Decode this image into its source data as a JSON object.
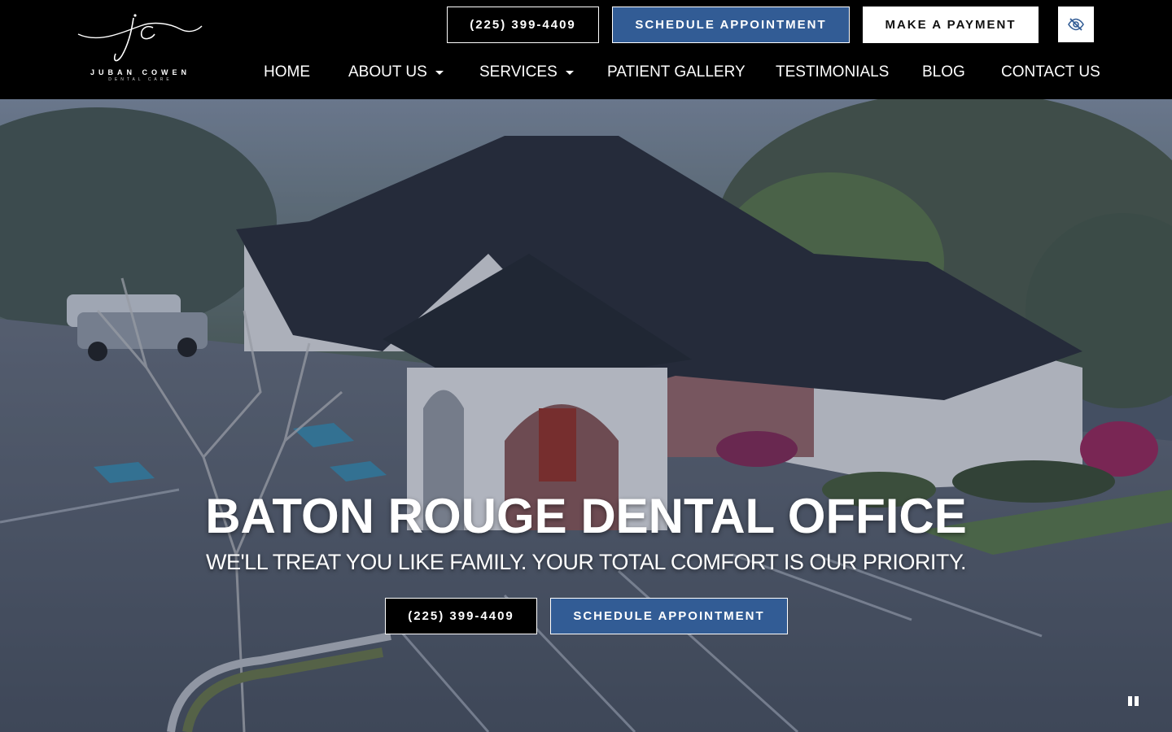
{
  "header": {
    "logo": {
      "monogram": "jc",
      "name": "JUBAN COWEN",
      "subtitle": "DENTAL CARE"
    },
    "phone_button": "(225) 399-4409",
    "schedule_button": "SCHEDULE APPOINTMENT",
    "payment_button": "MAKE A PAYMENT",
    "accessibility_icon": "eye-slash-icon"
  },
  "nav": {
    "items": [
      {
        "label": "HOME",
        "dropdown": false
      },
      {
        "label": "ABOUT US",
        "dropdown": true
      },
      {
        "label": "SERVICES",
        "dropdown": true
      },
      {
        "label": "PATIENT GALLERY",
        "dropdown": false
      },
      {
        "label": "TESTIMONIALS",
        "dropdown": false
      },
      {
        "label": "BLOG",
        "dropdown": false
      },
      {
        "label": "CONTACT US",
        "dropdown": false
      }
    ]
  },
  "hero": {
    "title": "BATON ROUGE DENTAL OFFICE",
    "subtitle": "WE'LL TREAT YOU LIKE FAMILY. YOUR TOTAL COMFORT IS OUR PRIORITY.",
    "phone_button": "(225) 399-4409",
    "schedule_button": "SCHEDULE APPOINTMENT",
    "pause_icon": "pause-icon"
  },
  "colors": {
    "header_bg": "#000000",
    "accent_blue": "#325c95",
    "text": "#ffffff"
  }
}
